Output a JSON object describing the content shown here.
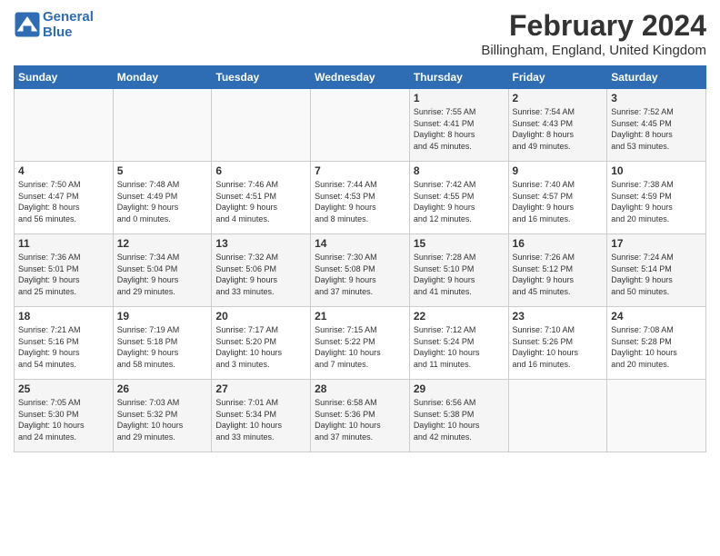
{
  "logo": {
    "line1": "General",
    "line2": "Blue"
  },
  "title": "February 2024",
  "subtitle": "Billingham, England, United Kingdom",
  "days_of_week": [
    "Sunday",
    "Monday",
    "Tuesday",
    "Wednesday",
    "Thursday",
    "Friday",
    "Saturday"
  ],
  "weeks": [
    [
      {
        "day": "",
        "info": ""
      },
      {
        "day": "",
        "info": ""
      },
      {
        "day": "",
        "info": ""
      },
      {
        "day": "",
        "info": ""
      },
      {
        "day": "1",
        "info": "Sunrise: 7:55 AM\nSunset: 4:41 PM\nDaylight: 8 hours\nand 45 minutes."
      },
      {
        "day": "2",
        "info": "Sunrise: 7:54 AM\nSunset: 4:43 PM\nDaylight: 8 hours\nand 49 minutes."
      },
      {
        "day": "3",
        "info": "Sunrise: 7:52 AM\nSunset: 4:45 PM\nDaylight: 8 hours\nand 53 minutes."
      }
    ],
    [
      {
        "day": "4",
        "info": "Sunrise: 7:50 AM\nSunset: 4:47 PM\nDaylight: 8 hours\nand 56 minutes."
      },
      {
        "day": "5",
        "info": "Sunrise: 7:48 AM\nSunset: 4:49 PM\nDaylight: 9 hours\nand 0 minutes."
      },
      {
        "day": "6",
        "info": "Sunrise: 7:46 AM\nSunset: 4:51 PM\nDaylight: 9 hours\nand 4 minutes."
      },
      {
        "day": "7",
        "info": "Sunrise: 7:44 AM\nSunset: 4:53 PM\nDaylight: 9 hours\nand 8 minutes."
      },
      {
        "day": "8",
        "info": "Sunrise: 7:42 AM\nSunset: 4:55 PM\nDaylight: 9 hours\nand 12 minutes."
      },
      {
        "day": "9",
        "info": "Sunrise: 7:40 AM\nSunset: 4:57 PM\nDaylight: 9 hours\nand 16 minutes."
      },
      {
        "day": "10",
        "info": "Sunrise: 7:38 AM\nSunset: 4:59 PM\nDaylight: 9 hours\nand 20 minutes."
      }
    ],
    [
      {
        "day": "11",
        "info": "Sunrise: 7:36 AM\nSunset: 5:01 PM\nDaylight: 9 hours\nand 25 minutes."
      },
      {
        "day": "12",
        "info": "Sunrise: 7:34 AM\nSunset: 5:04 PM\nDaylight: 9 hours\nand 29 minutes."
      },
      {
        "day": "13",
        "info": "Sunrise: 7:32 AM\nSunset: 5:06 PM\nDaylight: 9 hours\nand 33 minutes."
      },
      {
        "day": "14",
        "info": "Sunrise: 7:30 AM\nSunset: 5:08 PM\nDaylight: 9 hours\nand 37 minutes."
      },
      {
        "day": "15",
        "info": "Sunrise: 7:28 AM\nSunset: 5:10 PM\nDaylight: 9 hours\nand 41 minutes."
      },
      {
        "day": "16",
        "info": "Sunrise: 7:26 AM\nSunset: 5:12 PM\nDaylight: 9 hours\nand 45 minutes."
      },
      {
        "day": "17",
        "info": "Sunrise: 7:24 AM\nSunset: 5:14 PM\nDaylight: 9 hours\nand 50 minutes."
      }
    ],
    [
      {
        "day": "18",
        "info": "Sunrise: 7:21 AM\nSunset: 5:16 PM\nDaylight: 9 hours\nand 54 minutes."
      },
      {
        "day": "19",
        "info": "Sunrise: 7:19 AM\nSunset: 5:18 PM\nDaylight: 9 hours\nand 58 minutes."
      },
      {
        "day": "20",
        "info": "Sunrise: 7:17 AM\nSunset: 5:20 PM\nDaylight: 10 hours\nand 3 minutes."
      },
      {
        "day": "21",
        "info": "Sunrise: 7:15 AM\nSunset: 5:22 PM\nDaylight: 10 hours\nand 7 minutes."
      },
      {
        "day": "22",
        "info": "Sunrise: 7:12 AM\nSunset: 5:24 PM\nDaylight: 10 hours\nand 11 minutes."
      },
      {
        "day": "23",
        "info": "Sunrise: 7:10 AM\nSunset: 5:26 PM\nDaylight: 10 hours\nand 16 minutes."
      },
      {
        "day": "24",
        "info": "Sunrise: 7:08 AM\nSunset: 5:28 PM\nDaylight: 10 hours\nand 20 minutes."
      }
    ],
    [
      {
        "day": "25",
        "info": "Sunrise: 7:05 AM\nSunset: 5:30 PM\nDaylight: 10 hours\nand 24 minutes."
      },
      {
        "day": "26",
        "info": "Sunrise: 7:03 AM\nSunset: 5:32 PM\nDaylight: 10 hours\nand 29 minutes."
      },
      {
        "day": "27",
        "info": "Sunrise: 7:01 AM\nSunset: 5:34 PM\nDaylight: 10 hours\nand 33 minutes."
      },
      {
        "day": "28",
        "info": "Sunrise: 6:58 AM\nSunset: 5:36 PM\nDaylight: 10 hours\nand 37 minutes."
      },
      {
        "day": "29",
        "info": "Sunrise: 6:56 AM\nSunset: 5:38 PM\nDaylight: 10 hours\nand 42 minutes."
      },
      {
        "day": "",
        "info": ""
      },
      {
        "day": "",
        "info": ""
      }
    ]
  ]
}
